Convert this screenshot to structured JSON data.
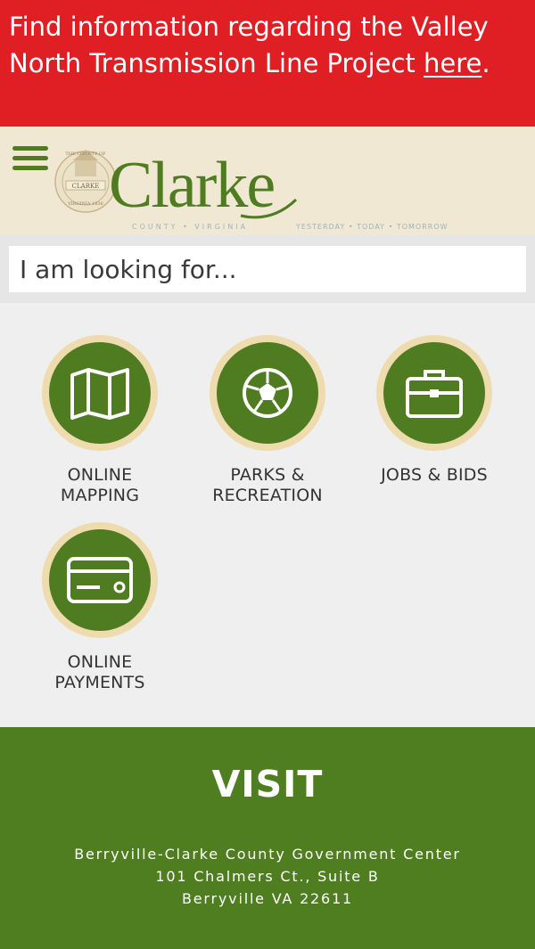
{
  "alert": {
    "text": "Find information regarding the Valley North Transmission Line Project ",
    "link_text": "here",
    "suffix": "."
  },
  "header": {
    "logo_name": "Clarke",
    "logo_subtitle_left": "COUNTY • VIRGINIA",
    "logo_subtitle_right": "YESTERDAY • TODAY • TOMORROW",
    "seal_text_top": "THE COUNTY OF",
    "seal_text_mid": "CLARKE",
    "seal_text_bottom": "VIRGINIA 1836"
  },
  "search": {
    "placeholder": "I am looking for..."
  },
  "quick_links": [
    {
      "label_line1": "ONLINE",
      "label_line2": "MAPPING",
      "icon": "map-icon"
    },
    {
      "label_line1": "PARKS &",
      "label_line2": "RECREATION",
      "icon": "soccer-ball-icon"
    },
    {
      "label_line1": "JOBS & BIDS",
      "label_line2": "",
      "icon": "briefcase-icon"
    },
    {
      "label_line1": "ONLINE",
      "label_line2": "PAYMENTS",
      "icon": "credit-card-icon"
    }
  ],
  "footer": {
    "heading": "VISIT",
    "address_line1": "Berryville-Clarke County Government Center",
    "address_line2": "101 Chalmers Ct., Suite B",
    "address_line3": "Berryville VA 22611"
  },
  "colors": {
    "alert_red": "#e01f25",
    "brand_green": "#4f7c20",
    "header_cream": "#f0e8d3",
    "circle_border": "#efdcae"
  }
}
